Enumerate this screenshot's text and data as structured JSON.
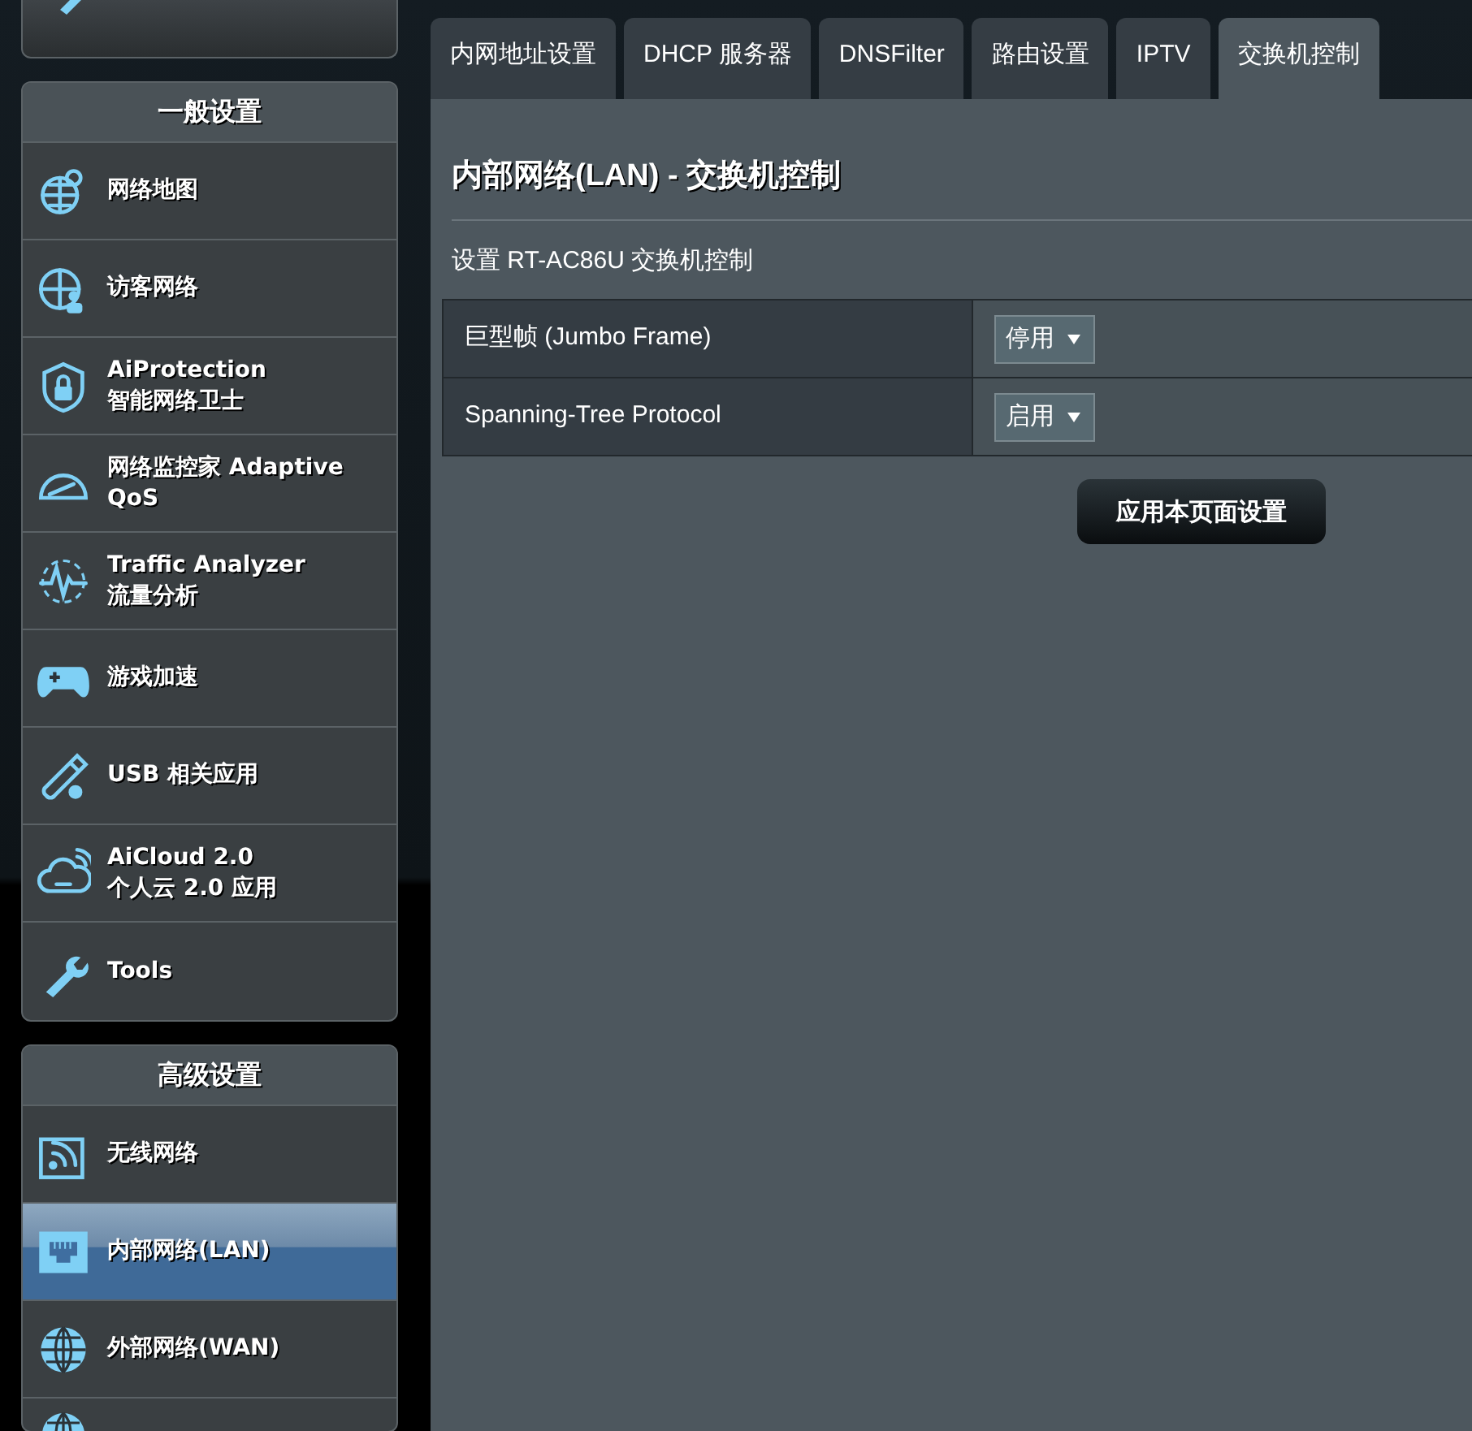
{
  "sidebar": {
    "sections": [
      {
        "title": "一般设置",
        "items": [
          {
            "lines": [
              "网络地图"
            ],
            "selected": false
          },
          {
            "lines": [
              "访客网络"
            ],
            "selected": false
          },
          {
            "lines": [
              "AiProtection",
              "智能网络卫士"
            ],
            "selected": false
          },
          {
            "lines": [
              "网络监控家 Adaptive",
              "QoS"
            ],
            "selected": false
          },
          {
            "lines": [
              "Traffic Analyzer",
              "流量分析"
            ],
            "selected": false
          },
          {
            "lines": [
              "游戏加速"
            ],
            "selected": false
          },
          {
            "lines": [
              "USB 相关应用"
            ],
            "selected": false
          },
          {
            "lines": [
              "AiCloud 2.0",
              "个人云 2.0 应用"
            ],
            "selected": false
          },
          {
            "lines": [
              "Tools"
            ],
            "selected": false
          }
        ]
      },
      {
        "title": "高级设置",
        "items": [
          {
            "lines": [
              "无线网络"
            ],
            "selected": false
          },
          {
            "lines": [
              "内部网络(LAN)"
            ],
            "selected": true
          },
          {
            "lines": [
              "外部网络(WAN)"
            ],
            "selected": false
          }
        ]
      }
    ]
  },
  "tabs": [
    {
      "label": "内网地址设置",
      "selected": false
    },
    {
      "label": "DHCP 服务器",
      "selected": false
    },
    {
      "label": "DNSFilter",
      "selected": false
    },
    {
      "label": "路由设置",
      "selected": false
    },
    {
      "label": "IPTV",
      "selected": false
    },
    {
      "label": "交换机控制",
      "selected": true
    }
  ],
  "page": {
    "title": "内部网络(LAN) - 交换机控制",
    "description": "设置 RT-AC86U 交换机控制",
    "settings": [
      {
        "label": "巨型帧 (Jumbo Frame)",
        "value": "停用"
      },
      {
        "label": "Spanning-Tree Protocol",
        "value": "启用"
      }
    ],
    "apply_button": "应用本页面设置"
  }
}
